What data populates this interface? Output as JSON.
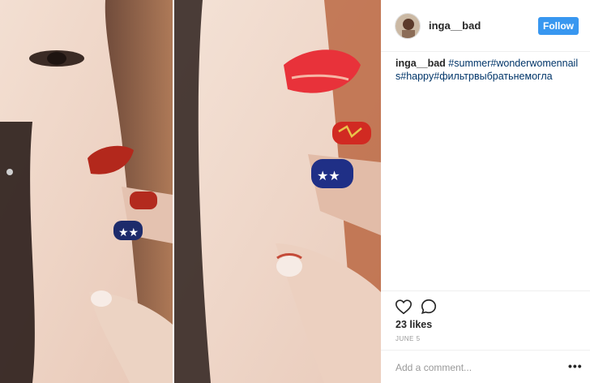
{
  "post": {
    "username": "inga__bad",
    "follow_label": "Follow",
    "caption_user": "inga__bad",
    "caption_text": " #summer#wonderwomennails#happy#фильтрвыбратьнемогла",
    "likes": "23 likes",
    "date": "June 5",
    "comment_placeholder": "Add a comment...",
    "more_label": "•••"
  },
  "icons": {
    "like": "heart-icon",
    "comment": "comment-icon",
    "more": "more-options-icon"
  },
  "colors": {
    "follow_bg": "#3897f0",
    "hashtag": "#003569",
    "divider": "#efefef"
  }
}
